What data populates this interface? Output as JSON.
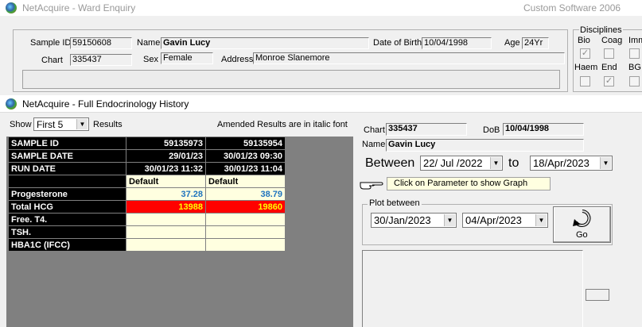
{
  "back_window": {
    "title": "NetAcquire - Ward Enquiry",
    "right_title": "Custom Software 2006",
    "sample_id_label": "Sample ID",
    "sample_id": "59150608",
    "name_label": "Name",
    "name": "Gavin Lucy",
    "dob_label": "Date of Birth",
    "dob": "10/04/1998",
    "age_label": "Age",
    "age": "24Yr",
    "chart_label": "Chart",
    "chart": "335437",
    "sex_label": "Sex",
    "sex": "Female",
    "address_label": "Address",
    "address": "Monroe Slanemore",
    "disciplines_label": "Disciplines",
    "disciplines": [
      {
        "label": "Bio",
        "checked": true
      },
      {
        "label": "Coag",
        "checked": false
      },
      {
        "label": "Imm",
        "checked": false
      },
      {
        "label": "Haem",
        "checked": false
      },
      {
        "label": "End",
        "checked": true
      },
      {
        "label": "BG",
        "checked": false
      }
    ]
  },
  "front_window": {
    "title": "NetAcquire - Full Endocrinology History",
    "show_label": "Show",
    "show_value": "First 5",
    "results_label": "Results",
    "amended_note": "Amended  Results are in italic font",
    "table": {
      "header_rows": [
        {
          "label": "SAMPLE ID",
          "values": [
            "59135973",
            "59135954"
          ]
        },
        {
          "label": "SAMPLE DATE",
          "values": [
            "29/01/23",
            "30/01/23 09:30"
          ]
        },
        {
          "label": "RUN DATE",
          "values": [
            "30/01/23 11:32",
            "30/01/23 11:04"
          ]
        }
      ],
      "defaults": [
        "Default",
        "Default"
      ],
      "rows": [
        {
          "label": "Progesterone",
          "values": [
            "37.28",
            "38.79"
          ],
          "style": "v"
        },
        {
          "label": "Total HCG",
          "values": [
            "13988",
            "19860"
          ],
          "style": "r"
        },
        {
          "label": "Free. T4.",
          "values": [
            "",
            ""
          ],
          "style": "e"
        },
        {
          "label": "TSH.",
          "values": [
            "",
            ""
          ],
          "style": "e"
        },
        {
          "label": "HBA1C (IFCC)",
          "values": [
            "",
            ""
          ],
          "style": "e"
        }
      ]
    },
    "chart_label": "Chart",
    "chart": "335437",
    "dob_label": "DoB",
    "dob": "10/04/1998",
    "name_label": "Name",
    "name": "Gavin Lucy",
    "between_label": "Between",
    "between_from": "22/ Jul /2022",
    "to_label": "to",
    "between_to": "18/Apr/2023",
    "hint": "Click on Parameter to show Graph",
    "plot_label": "Plot between",
    "plot_from": "30/Jan/2023",
    "plot_to": "04/Apr/2023",
    "go_label": "Go"
  },
  "colors": {
    "header_bg": "#000000",
    "cell_bg": "#ffffe0",
    "value_blue": "#1e73be",
    "alert_red": "#ff0000",
    "alert_text": "#ffff00"
  }
}
